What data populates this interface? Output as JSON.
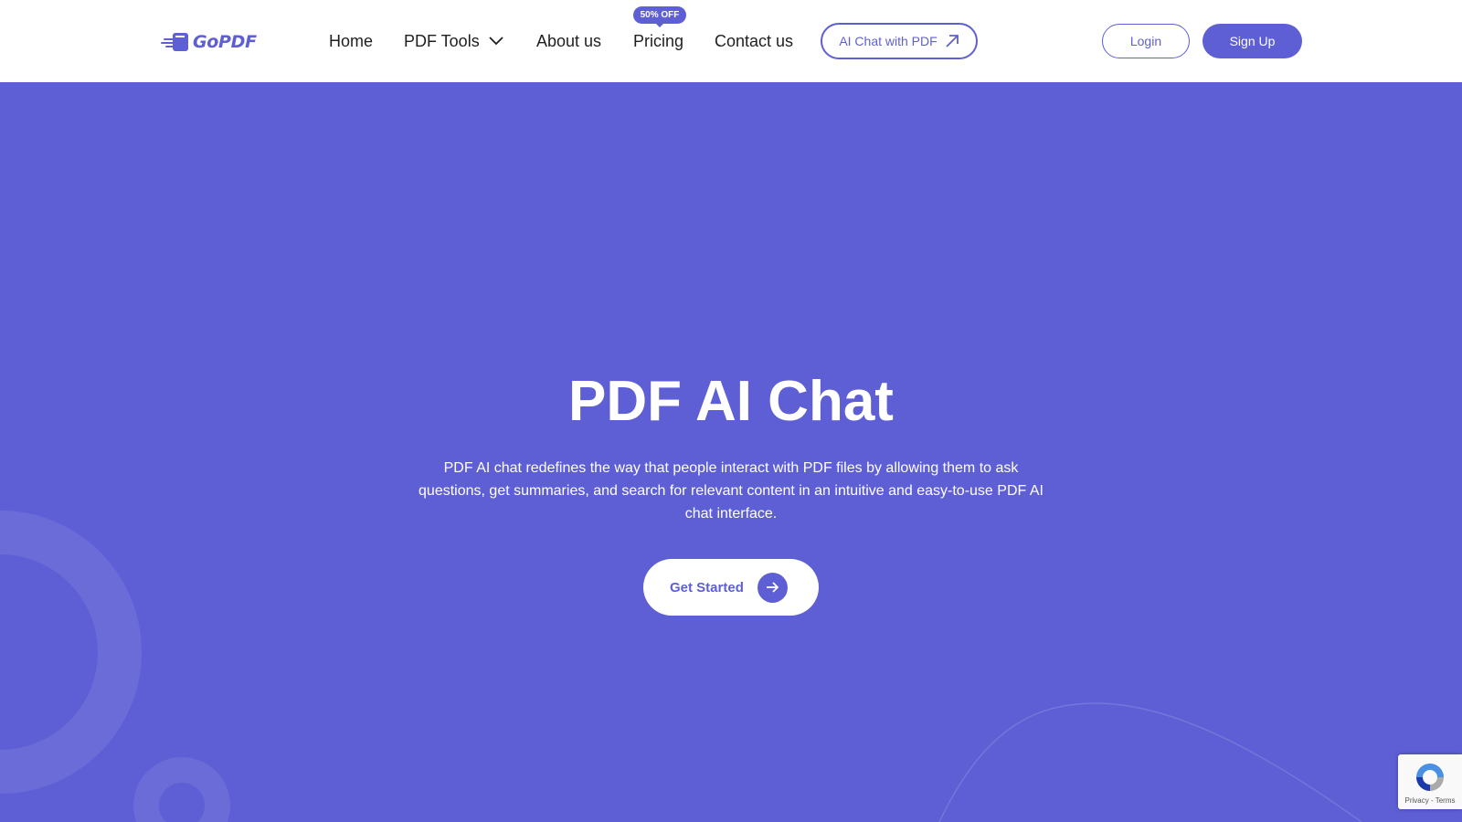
{
  "header": {
    "logo_text": "GoPDF",
    "nav": {
      "home": "Home",
      "pdf_tools": "PDF Tools",
      "about": "About us",
      "pricing": "Pricing",
      "contact": "Contact us"
    },
    "pricing_badge": "50% OFF",
    "ai_chat_button": "AI Chat with PDF",
    "login_button": "Login",
    "signup_button": "Sign Up"
  },
  "hero": {
    "title": "PDF AI Chat",
    "description": "PDF AI chat redefines the way that people interact with PDF files by allowing them to ask questions, get summaries, and search for relevant content in an intuitive and easy-to-use PDF AI chat interface.",
    "cta": "Get Started"
  },
  "recaptcha": {
    "privacy": "Privacy",
    "separator": " - ",
    "terms": "Terms"
  },
  "colors": {
    "brand": "#5e5fd5",
    "background": "#5e5fd5",
    "white": "#ffffff",
    "text_dark": "#1f1f1f"
  },
  "icons": [
    "goPDF-logo-icon",
    "chevron-down-icon",
    "arrow-up-right-icon",
    "arrow-right-icon",
    "recaptcha-icon"
  ]
}
